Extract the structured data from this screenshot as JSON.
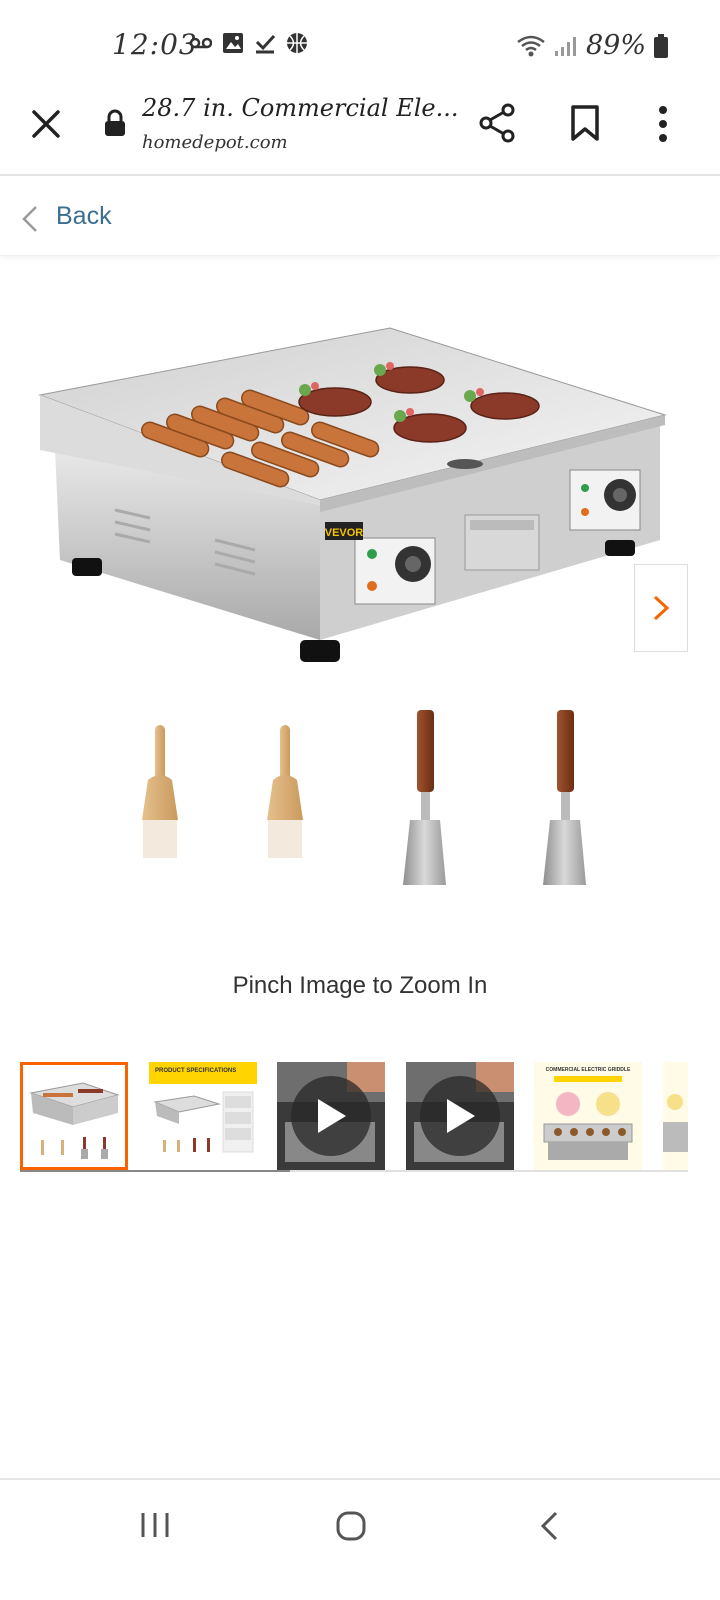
{
  "status_bar": {
    "time": "12:03",
    "battery_percent": "89%"
  },
  "browser": {
    "title": "28.7 in. Commercial Ele...",
    "domain": "homedepot.com"
  },
  "nav": {
    "back_label": "Back"
  },
  "product": {
    "brand_label": "VEVOR"
  },
  "zoom_hint": "Pinch Image to Zoom In",
  "thumbnails": [
    {
      "kind": "image",
      "selected": true
    },
    {
      "kind": "image",
      "selected": false,
      "caption": "PRODUCT SPECIFICATIONS"
    },
    {
      "kind": "video",
      "selected": false
    },
    {
      "kind": "video",
      "selected": false
    },
    {
      "kind": "image",
      "selected": false,
      "caption": "COMMERCIAL ELECTRIC GRIDDLE"
    },
    {
      "kind": "image",
      "selected": false
    }
  ],
  "colors": {
    "accent": "#f96302",
    "link": "#3b6e8f"
  }
}
